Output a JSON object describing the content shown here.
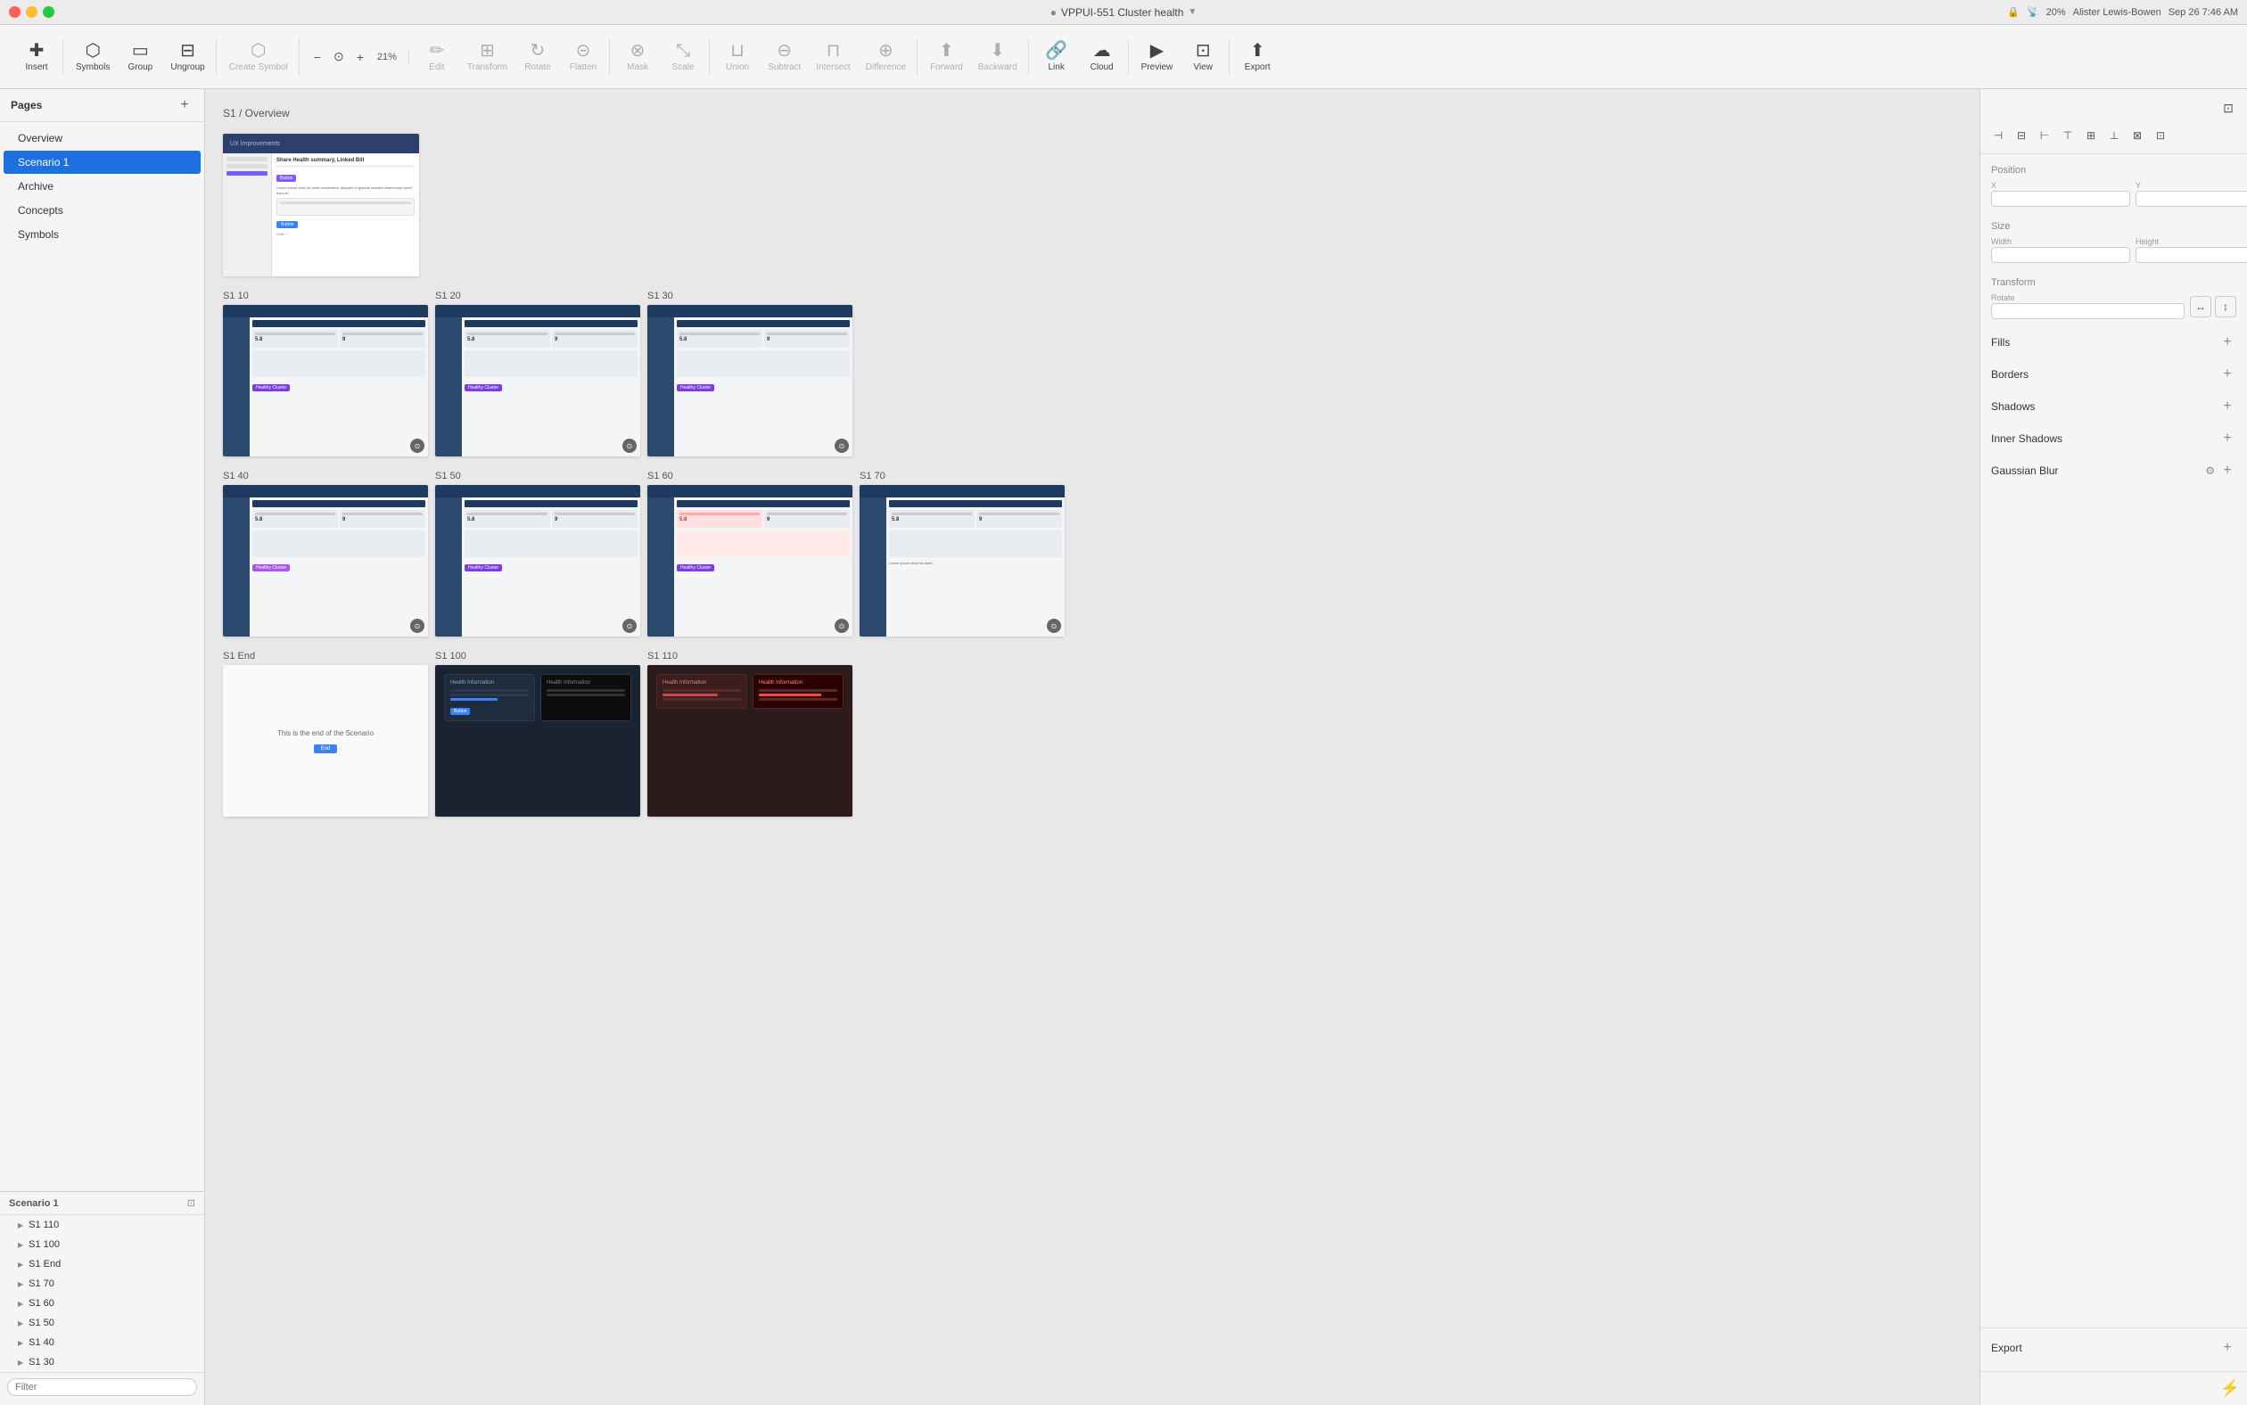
{
  "titlebar": {
    "title": "VPPUI-551 Cluster health",
    "system_icons": [
      "wifi",
      "battery",
      "clock"
    ],
    "battery_percent": "20%",
    "user": "Alister Lewis-Bowen",
    "date": "Sep 26  7:46 AM"
  },
  "toolbar": {
    "insert_label": "Insert",
    "symbols_label": "Symbols",
    "group_label": "Group",
    "ungroup_label": "Ungroup",
    "create_symbol_label": "Create Symbol",
    "zoom_level": "21%",
    "edit_label": "Edit",
    "transform_label": "Transform",
    "rotate_label": "Rotate",
    "flatten_label": "Flatten",
    "mask_label": "Mask",
    "scale_label": "Scale",
    "union_label": "Union",
    "subtract_label": "Subtract",
    "intersect_label": "Intersect",
    "difference_label": "Difference",
    "forward_label": "Forward",
    "backward_label": "Backward",
    "link_label": "Link",
    "cloud_label": "Cloud",
    "preview_label": "Preview",
    "view_label": "View",
    "export_label": "Export"
  },
  "pages": {
    "title": "Pages",
    "add_button_label": "+",
    "items": [
      {
        "label": "Overview",
        "id": "overview"
      },
      {
        "label": "Scenario 1",
        "id": "scenario1",
        "active": true
      },
      {
        "label": "Archive",
        "id": "archive"
      },
      {
        "label": "Concepts",
        "id": "concepts"
      },
      {
        "label": "Symbols",
        "id": "symbols"
      }
    ]
  },
  "canvas": {
    "breadcrumb": "S1 / Overview"
  },
  "artboards": [
    {
      "label": "",
      "id": "s1-overview",
      "size": "overview"
    },
    {
      "label": "S1 10",
      "id": "s1-10",
      "size": "md"
    },
    {
      "label": "S1 20",
      "id": "s1-20",
      "size": "md"
    },
    {
      "label": "S1 30",
      "id": "s1-30",
      "size": "md"
    },
    {
      "label": "S1 40",
      "id": "s1-40",
      "size": "md"
    },
    {
      "label": "S1 50",
      "id": "s1-50",
      "size": "md"
    },
    {
      "label": "S1 60",
      "id": "s1-60",
      "size": "md"
    },
    {
      "label": "S1 70",
      "id": "s1-70",
      "size": "md"
    },
    {
      "label": "S1 End",
      "id": "s1-end",
      "size": "end"
    },
    {
      "label": "S1 100",
      "id": "s1-100",
      "size": "md"
    },
    {
      "label": "S1 110",
      "id": "s1-110",
      "size": "md"
    }
  ],
  "layers": {
    "title": "Scenario 1",
    "items": [
      {
        "label": "S1 110",
        "id": "s1-110"
      },
      {
        "label": "S1 100",
        "id": "s1-100"
      },
      {
        "label": "S1 End",
        "id": "s1-end"
      },
      {
        "label": "S1 70",
        "id": "s1-70"
      },
      {
        "label": "S1 60",
        "id": "s1-60"
      },
      {
        "label": "S1 50",
        "id": "s1-50"
      },
      {
        "label": "S1 40",
        "id": "s1-40"
      },
      {
        "label": "S1 30",
        "id": "s1-30"
      }
    ],
    "filter_placeholder": "Filter"
  },
  "right_panel": {
    "position_label": "Position",
    "x_label": "X",
    "y_label": "Y",
    "size_label": "Size",
    "width_label": "Width",
    "height_label": "Height",
    "transform_label": "Transform",
    "rotate_label": "Rotate",
    "flip_label": "Flip",
    "fills_label": "Fills",
    "borders_label": "Borders",
    "shadows_label": "Shadows",
    "inner_shadows_label": "Inner Shadows",
    "gaussian_blur_label": "Gaussian Blur",
    "export_label": "Export"
  }
}
